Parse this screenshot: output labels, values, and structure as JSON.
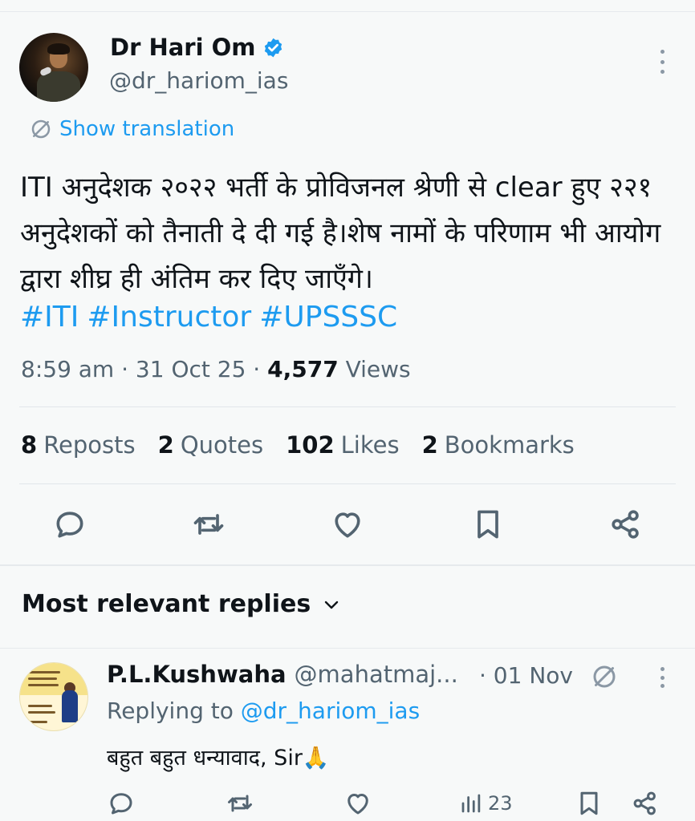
{
  "author": {
    "name": "Dr Hari Om",
    "handle": "@dr_hariom_ias"
  },
  "translation_label": "Show translation",
  "tweet": {
    "text": "ITI अनुदेशक २०२२ भर्ती के प्रोविजनल श्रेणी से clear हुए २२१ अनुदेशकों को तैनाती दे दी गई है।शेष नामों के परिणाम भी आयोग द्वारा शीघ्र ही अंतिम कर दिए जाएँगे।",
    "hashtags": [
      "#ITI",
      "#Instructor",
      "#UPSSSC"
    ],
    "time": "8:59 am",
    "date": "31 Oct 25",
    "views_count": "4,577",
    "views_label": "Views"
  },
  "stats": {
    "reposts_count": "8",
    "reposts_label": "Reposts",
    "quotes_count": "2",
    "quotes_label": "Quotes",
    "likes_count": "102",
    "likes_label": "Likes",
    "bookmarks_count": "2",
    "bookmarks_label": "Bookmarks"
  },
  "icons": {
    "reply": "reply-icon",
    "repost": "repost-icon",
    "like": "heart-icon",
    "bookmark": "bookmark-icon",
    "share": "share-icon",
    "views": "views-icon"
  },
  "colors": {
    "accent": "#1d9bf0",
    "secondary_text": "#536471",
    "primary_text": "#0f1419",
    "background": "#f7f9f9"
  },
  "replies_sort_label": "Most relevant replies",
  "reply": {
    "name": "P.L.Kushwaha",
    "handle": "@mahatmaj...",
    "date": "· 01 Nov",
    "replying_prefix": "Replying to",
    "replying_to": "@dr_hariom_ias",
    "text": "बहुत बहुत धन्यावाद, Sir🙏",
    "views_count": "23"
  }
}
